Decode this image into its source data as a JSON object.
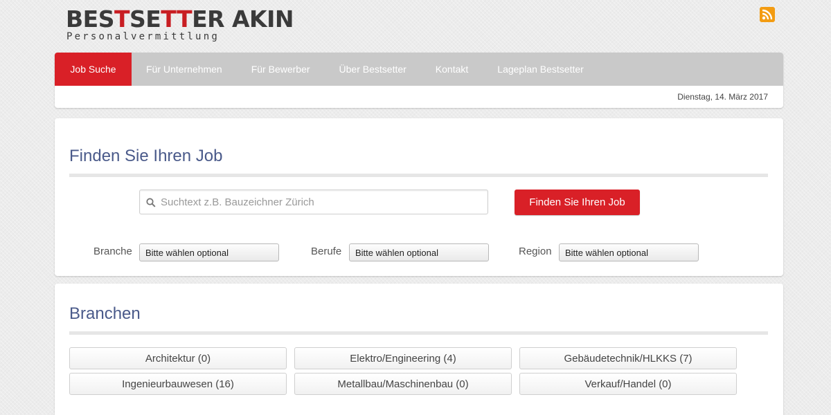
{
  "header": {
    "logo_text_1": "BES",
    "logo_text_2": "T",
    "logo_text_3": "SE",
    "logo_text_4": "TT",
    "logo_text_5": "ER AKIN",
    "logo_subtitle": "Personalvermittlung",
    "rss_icon": "rss-icon"
  },
  "nav": {
    "items": [
      {
        "label": "Job Suche"
      },
      {
        "label": "Für Unternehmen"
      },
      {
        "label": "Für Bewerber"
      },
      {
        "label": "Über Bestsetter"
      },
      {
        "label": "Kontakt"
      },
      {
        "label": "Lageplan Bestsetter"
      }
    ],
    "date": "Dienstag, 14. März 2017"
  },
  "search": {
    "title": "Finden Sie Ihren Job",
    "placeholder": "Suchtext z.B. Bauzeichner Zürich",
    "button_label": "Finden Sie Ihren Job",
    "filters": [
      {
        "label": "Branche",
        "value": "Bitte wählen optional"
      },
      {
        "label": "Berufe",
        "value": "Bitte wählen optional"
      },
      {
        "label": "Region",
        "value": "Bitte wählen optional"
      }
    ]
  },
  "branches": {
    "title": "Branchen",
    "items": [
      {
        "label": "Architektur (0)"
      },
      {
        "label": "Elektro/Engineering (4)"
      },
      {
        "label": "Gebäudetechnik/HLKKS (7)"
      },
      {
        "label": "Ingenieurbauwesen (16)"
      },
      {
        "label": "Metallbau/Maschinenbau (0)"
      },
      {
        "label": "Verkauf/Handel (0)"
      }
    ]
  },
  "colors": {
    "accent": "#d92027",
    "nav_bg": "#c9c9c9",
    "title": "#4a5a8a",
    "rss": "#f39c12"
  }
}
